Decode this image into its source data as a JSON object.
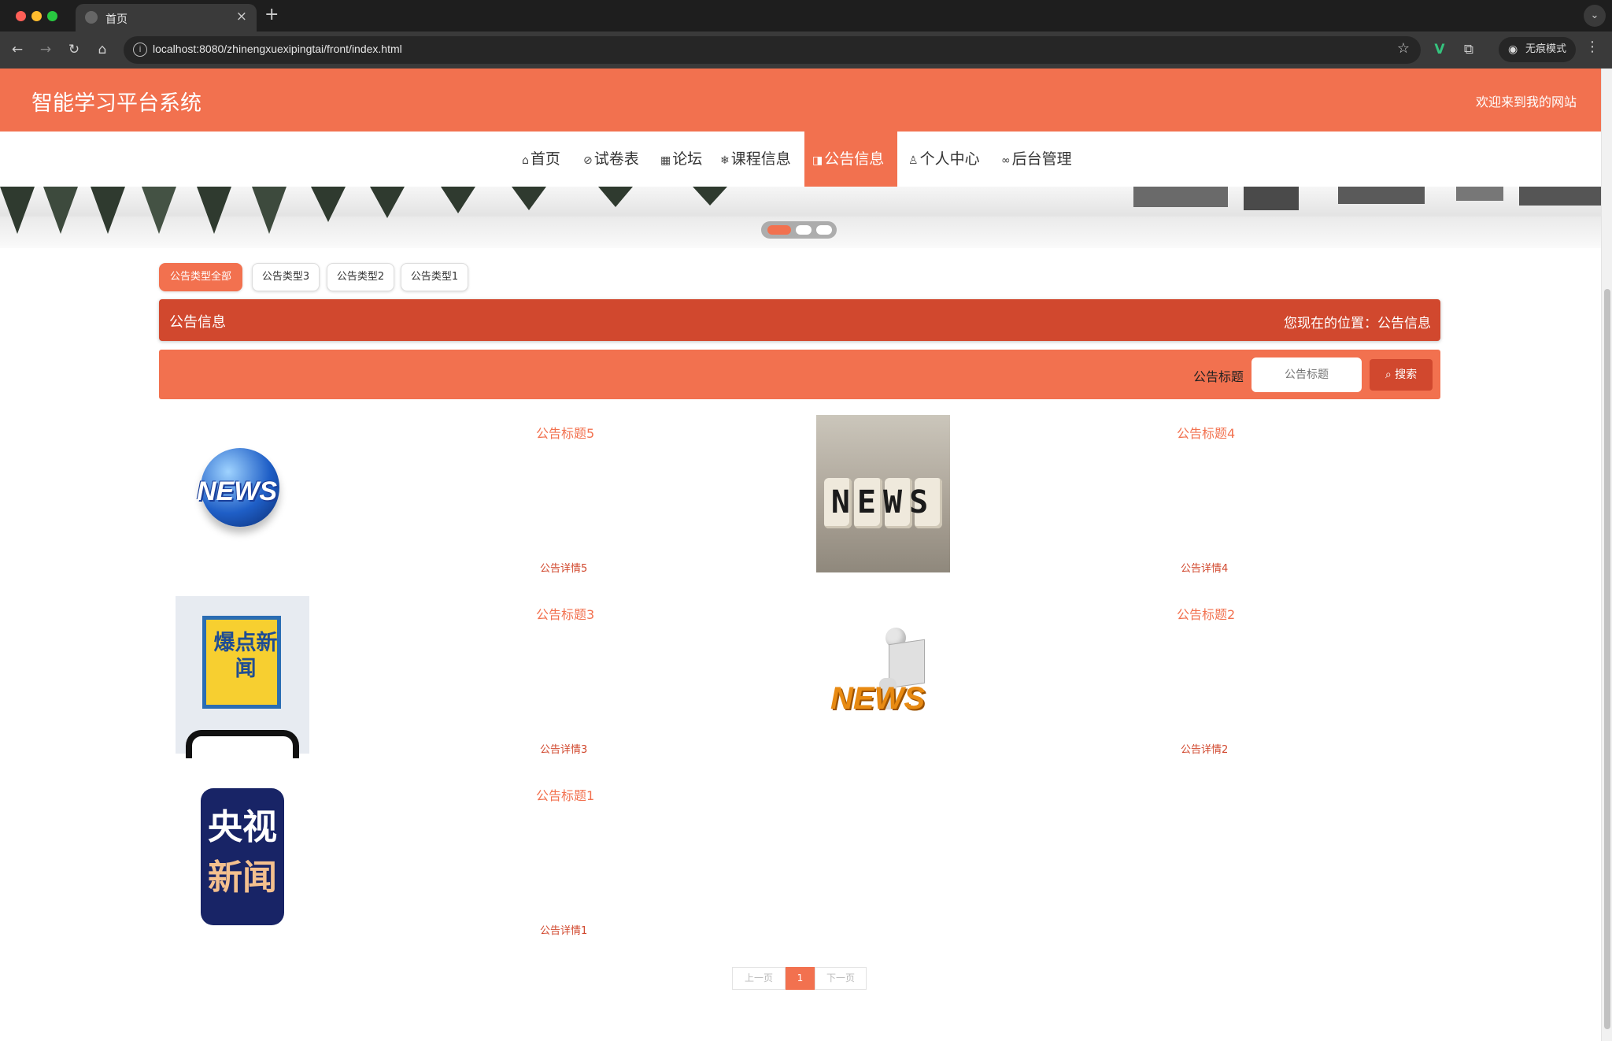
{
  "browser": {
    "tab_title": "首页",
    "url": "localhost:8080/zhinengxuexipingtai/front/index.html",
    "incognito_label": "无痕模式"
  },
  "colors": {
    "accent": "#f2714f",
    "dark_accent": "#d1482e"
  },
  "header": {
    "site_title": "智能学习平台系统",
    "welcome": "欢迎来到我的网站"
  },
  "nav": {
    "items": [
      {
        "icon": "home-icon",
        "label": "首页"
      },
      {
        "icon": "paperclip-icon",
        "label": "试卷表"
      },
      {
        "icon": "calendar-icon",
        "label": "论坛"
      },
      {
        "icon": "snowflake-icon",
        "label": "课程信息"
      },
      {
        "icon": "megaphone-icon",
        "label": "公告信息"
      },
      {
        "icon": "user-icon",
        "label": "个人中心"
      },
      {
        "icon": "link-icon",
        "label": "后台管理"
      }
    ],
    "active": "公告信息"
  },
  "filters": [
    "公告类型全部",
    "公告类型3",
    "公告类型2",
    "公告类型1"
  ],
  "breadcrumb": {
    "title": "公告信息",
    "position": "您现在的位置：公告信息"
  },
  "search": {
    "label": "公告标题",
    "placeholder": "公告标题",
    "button": "搜索"
  },
  "notices": [
    {
      "title": "公告标题5",
      "detail": "公告详情5",
      "image": "news-globe"
    },
    {
      "title": "公告标题4",
      "detail": "公告详情4",
      "image": "news-dice"
    },
    {
      "title": "公告标题3",
      "detail": "公告详情3",
      "image": "breaking-news-poster"
    },
    {
      "title": "公告标题2",
      "detail": "公告详情2",
      "image": "news-reader-figure"
    },
    {
      "title": "公告标题1",
      "detail": "公告详情1",
      "image": "cctv-news-logo"
    }
  ],
  "image_text": {
    "globe": "NEWS",
    "dice": "NEWS",
    "poster": "爆点新闻",
    "figure": "NEWS",
    "logo_line1": "央视",
    "logo_line2": "新闻"
  },
  "pagination": {
    "prev": "上一页",
    "current": "1",
    "next": "下一页"
  }
}
